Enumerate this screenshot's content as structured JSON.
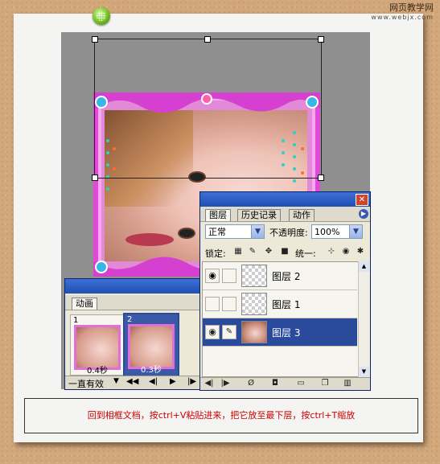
{
  "watermark": {
    "line1": "网页教学网",
    "line2": "www.webjx.com"
  },
  "layers_panel": {
    "tabs": [
      "图层",
      "历史记录",
      "动作"
    ],
    "blend_mode": "正常",
    "opacity_label": "不透明度:",
    "opacity_value": "100%",
    "lock_label": "锁定:",
    "unify_label": "统一:",
    "layers": [
      {
        "name": "图层 2",
        "visible": true,
        "selected": false
      },
      {
        "name": "图层 1",
        "visible": false,
        "selected": false
      },
      {
        "name": "图层 3",
        "visible": true,
        "selected": true
      }
    ]
  },
  "animation_panel": {
    "tab": "动画",
    "frames": [
      {
        "index": "1",
        "delay": "0.4秒"
      },
      {
        "index": "2",
        "delay": "0.3秒"
      }
    ],
    "loop": "一直有效"
  },
  "caption": "回到相框文档，按ctrl+V粘贴进来，把它放至最下层，按ctrl+T缩放",
  "colors": {
    "accent": "#2a4a9c",
    "caption": "#cc0000",
    "frame": "#e070d8"
  },
  "icons": [
    "close-icon",
    "eye-icon",
    "brush-icon",
    "lock-icon",
    "link-icon",
    "play-icon",
    "trash-icon",
    "new-layer-icon"
  ]
}
